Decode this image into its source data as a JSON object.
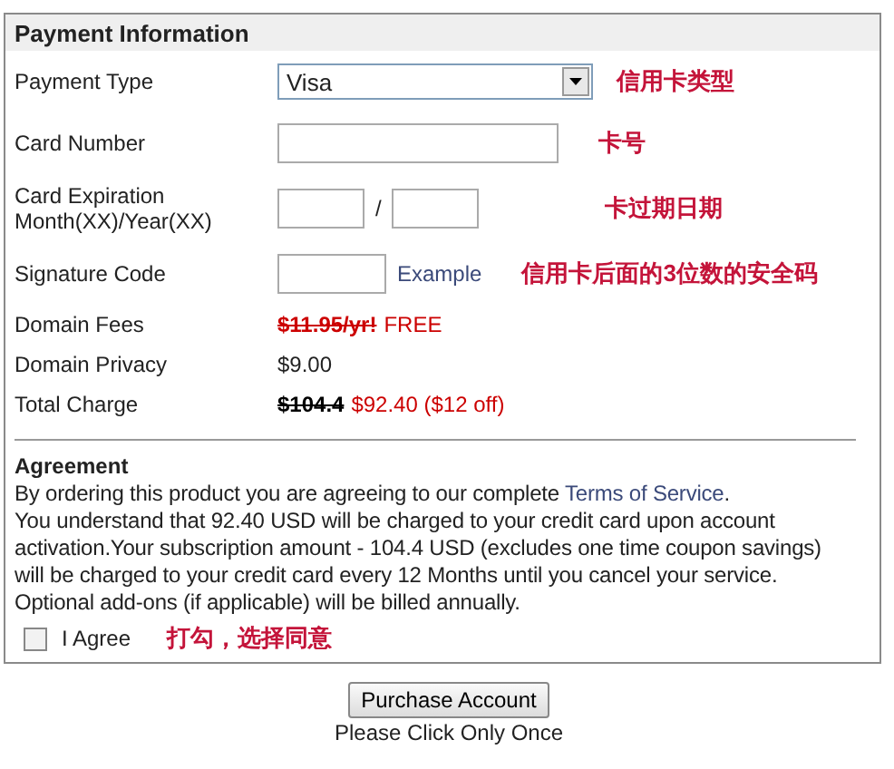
{
  "panel": {
    "title": "Payment Information"
  },
  "rows": [
    {
      "kind": "select",
      "label": "Payment Type",
      "value": "Visa",
      "note": "信用卡类型"
    },
    {
      "kind": "text",
      "label": "Card Number",
      "note": "卡号"
    },
    {
      "kind": "expiry",
      "label": "Card Expiration",
      "label_2": "Month(XX)/Year(XX)",
      "separator": "/",
      "note": "卡过期日期"
    },
    {
      "kind": "signature",
      "label": "Signature Code",
      "link": "Example",
      "note": "信用卡后面的3位数的安全码"
    },
    {
      "kind": "discount",
      "label": "Domain Fees",
      "old_price": "$11.95/yr!",
      "new_price": "FREE",
      "old_red": true
    },
    {
      "kind": "plain",
      "label": "Domain Privacy",
      "value": "$9.00"
    },
    {
      "kind": "discount",
      "label": "Total Charge",
      "old_price": "$104.4",
      "new_price": "$92.40 ($12 off)",
      "old_red": false
    }
  ],
  "agreement": {
    "title": "Agreement",
    "intro": "By ordering this product you are agreeing to our complete ",
    "link": "Terms of Service",
    "after_link": ".",
    "lines": [
      "You understand that 92.40 USD will be charged to your credit card upon account",
      "activation.Your subscription amount - 104.4 USD (excludes one time coupon savings)",
      "will be charged to your credit card every 12 Months until you cancel your service.",
      "Optional add-ons (if applicable) will be billed annually."
    ],
    "checkbox": {
      "label": "I Agree",
      "checked": false,
      "note": "打勾，选择同意"
    }
  },
  "button": "Purchase Account",
  "caption": "Please Click Only Once"
}
